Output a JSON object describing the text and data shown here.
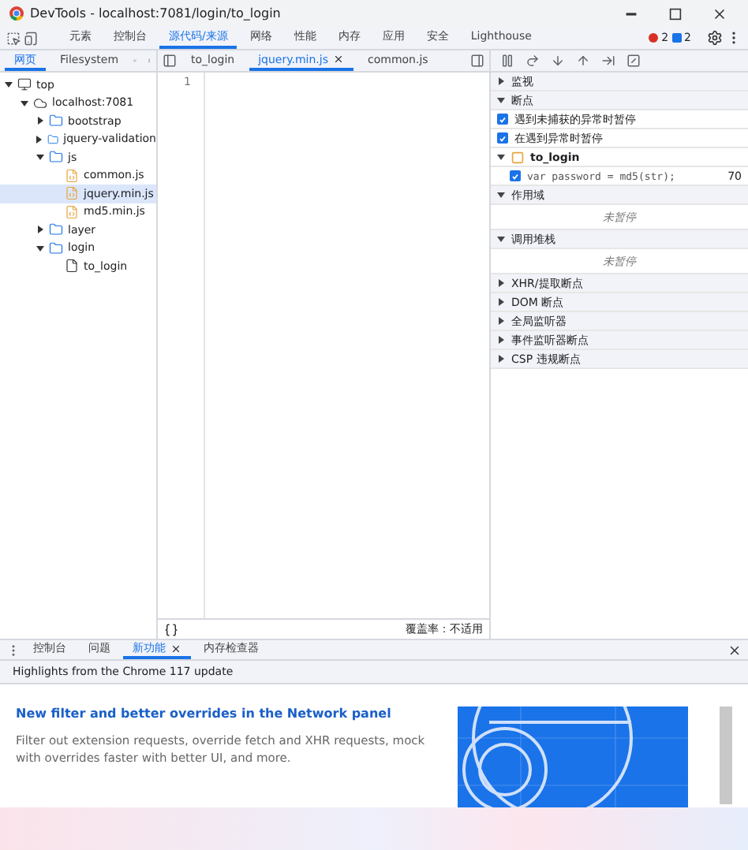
{
  "window": {
    "title": "DevTools - localhost:7081/login/to_login"
  },
  "main_tabs": [
    {
      "label": "元素",
      "selected": false
    },
    {
      "label": "控制台",
      "selected": false
    },
    {
      "label": "源代码/来源",
      "selected": true
    },
    {
      "label": "网络",
      "selected": false
    },
    {
      "label": "性能",
      "selected": false
    },
    {
      "label": "内存",
      "selected": false
    },
    {
      "label": "应用",
      "selected": false
    },
    {
      "label": "安全",
      "selected": false
    },
    {
      "label": "Lighthouse",
      "selected": false
    }
  ],
  "error_count": "2",
  "message_count": "2",
  "navigator_tabs": [
    {
      "label": "网页",
      "selected": true
    },
    {
      "label": "Filesystem",
      "selected": false
    }
  ],
  "editor_tabs": [
    {
      "label": "to_login",
      "selected": false,
      "closable": false
    },
    {
      "label": "jquery.min.js",
      "selected": true,
      "closable": true
    },
    {
      "label": "common.js",
      "selected": false,
      "closable": false
    }
  ],
  "tree": [
    {
      "label": "top",
      "kind": "frame",
      "expanded": true,
      "selected": false,
      "children": [
        {
          "label": "localhost:7081",
          "kind": "origin",
          "expanded": true,
          "selected": false,
          "children": [
            {
              "label": "bootstrap",
              "kind": "folder",
              "expanded": false,
              "selected": false
            },
            {
              "label": "jquery-validation",
              "kind": "folder",
              "expanded": false,
              "selected": false
            },
            {
              "label": "js",
              "kind": "folder",
              "expanded": true,
              "selected": false,
              "children": [
                {
                  "label": "common.js",
                  "kind": "script",
                  "selected": false
                },
                {
                  "label": "jquery.min.js",
                  "kind": "script",
                  "selected": true
                },
                {
                  "label": "md5.min.js",
                  "kind": "script",
                  "selected": false
                }
              ]
            },
            {
              "label": "layer",
              "kind": "folder",
              "expanded": false,
              "selected": false
            },
            {
              "label": "login",
              "kind": "folder",
              "expanded": true,
              "selected": false,
              "children": [
                {
                  "label": "to_login",
                  "kind": "document",
                  "selected": false
                }
              ]
            }
          ]
        }
      ]
    }
  ],
  "editor": {
    "line_numbers": [
      "1"
    ],
    "coverage": "覆盖率：不适用"
  },
  "debugger": [
    {
      "kind": "section",
      "label": "监视",
      "expanded": false
    },
    {
      "kind": "section",
      "label": "断点",
      "expanded": true
    },
    {
      "kind": "checkbox",
      "label": "遇到未捕获的异常时暂停",
      "checked": true
    },
    {
      "kind": "checkbox",
      "label": "在遇到异常时暂停",
      "checked": true
    },
    {
      "kind": "file",
      "label": "to_login",
      "expanded": true
    },
    {
      "kind": "breakpoint",
      "label": "var password = md5(str);",
      "line": "70",
      "checked": true
    },
    {
      "kind": "section",
      "label": "作用域",
      "expanded": true
    },
    {
      "kind": "note",
      "label": "未暂停"
    },
    {
      "kind": "section",
      "label": "调用堆栈",
      "expanded": true
    },
    {
      "kind": "note",
      "label": "未暂停"
    },
    {
      "kind": "section",
      "label": "XHR/提取断点",
      "expanded": false
    },
    {
      "kind": "section",
      "label": "DOM 断点",
      "expanded": false
    },
    {
      "kind": "section",
      "label": "全局监听器",
      "expanded": false
    },
    {
      "kind": "section",
      "label": "事件监听器断点",
      "expanded": false
    },
    {
      "kind": "section",
      "label": "CSP 违规断点",
      "expanded": false
    }
  ],
  "drawer_tabs": [
    {
      "label": "控制台",
      "selected": false,
      "closable": false
    },
    {
      "label": "问题",
      "selected": false,
      "closable": false
    },
    {
      "label": "新功能",
      "selected": true,
      "closable": true
    },
    {
      "label": "内存检查器",
      "selected": false,
      "closable": false
    }
  ],
  "whats_new": {
    "header": "Highlights from the Chrome 117 update",
    "title": "New filter and better overrides in the Network panel",
    "body": "Filter out extension requests, override fetch and XHR requests, mock with overrides faster with better UI, and more."
  }
}
